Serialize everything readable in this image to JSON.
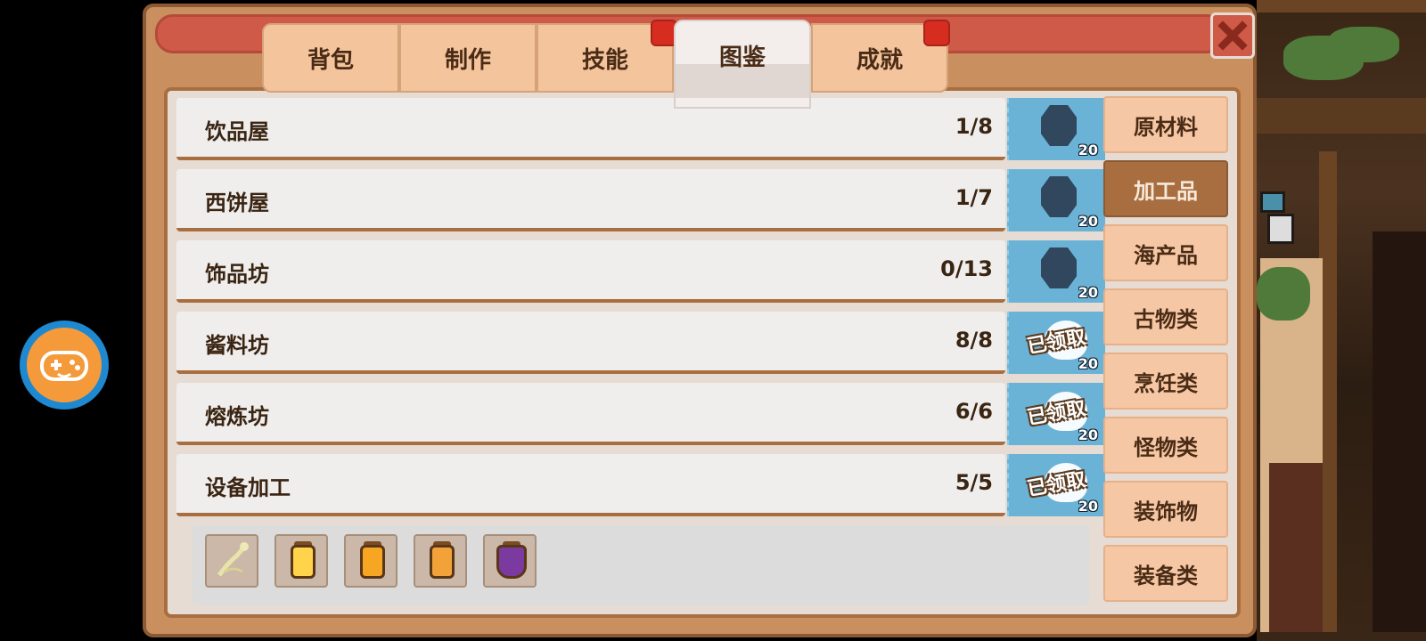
{
  "tabs": [
    {
      "label": "背包",
      "active": false
    },
    {
      "label": "制作",
      "active": false
    },
    {
      "label": "技能",
      "active": false
    },
    {
      "label": "图鉴",
      "active": true
    },
    {
      "label": "成就",
      "active": false
    }
  ],
  "rows": [
    {
      "name": "饮品屋",
      "count": "1/8",
      "reward_qty": "20",
      "claimed": false
    },
    {
      "name": "西饼屋",
      "count": "1/7",
      "reward_qty": "20",
      "claimed": false
    },
    {
      "name": "饰品坊",
      "count": "0/13",
      "reward_qty": "20",
      "claimed": false
    },
    {
      "name": "酱料坊",
      "count": "8/8",
      "reward_qty": "20",
      "claimed": true
    },
    {
      "name": "熔炼坊",
      "count": "6/6",
      "reward_qty": "20",
      "claimed": true
    },
    {
      "name": "设备加工",
      "count": "5/5",
      "reward_qty": "20",
      "claimed": true
    }
  ],
  "claimed_label": "已领取",
  "items": [
    {
      "icon": "rope-icon",
      "color": "#e8e3a8"
    },
    {
      "icon": "yellow-jar-icon",
      "color": "#ffd34a"
    },
    {
      "icon": "orange-jar-icon",
      "color": "#f6a623"
    },
    {
      "icon": "orange-jar-icon",
      "color": "#f3a23a"
    },
    {
      "icon": "purple-potion-icon",
      "color": "#7a3aa0"
    }
  ],
  "categories": [
    {
      "label": "原材料",
      "active": false
    },
    {
      "label": "加工品",
      "active": true
    },
    {
      "label": "海产品",
      "active": false
    },
    {
      "label": "古物类",
      "active": false
    },
    {
      "label": "烹饪类",
      "active": false
    },
    {
      "label": "怪物类",
      "active": false
    },
    {
      "label": "装饰物",
      "active": false
    },
    {
      "label": "装备类",
      "active": false
    }
  ],
  "colors": {
    "panel": "#c98f5e",
    "title_bar": "#cf5a47",
    "reward_bg": "#6bb3d6",
    "category_active": "#a86e40"
  }
}
